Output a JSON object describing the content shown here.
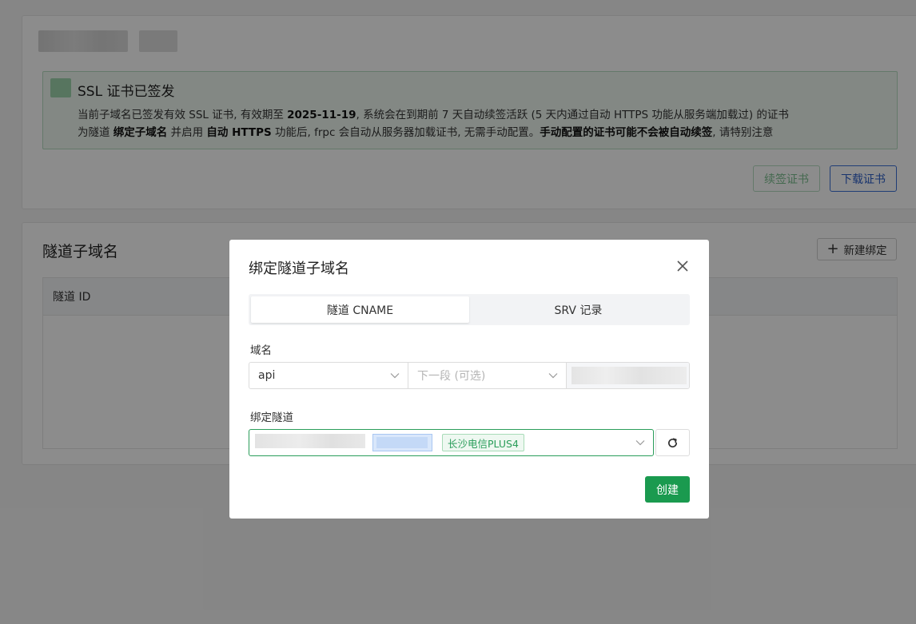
{
  "cert_card": {
    "alert": {
      "title": "SSL 证书已签发",
      "line1_prefix": "当前子域名已签发有效 SSL 证书, 有效期至 ",
      "expiry": "2025-11-19",
      "line1_suffix": ", 系统会在到期前 7 天自动续签活跃 (5 天内通过自动 HTTPS 功能从服务端加载过) 的证书",
      "line2_a": "为隧道 ",
      "line2_b": "绑定子域名",
      "line2_c": " 并启用 ",
      "line2_d": "自动 HTTPS",
      "line2_e": " 功能后, frpc 会自动从服务器加载证书, 无需手动配置。",
      "line2_f": "手动配置的证书可能不会被自动续签",
      "line2_g": ", 请特别注意"
    },
    "renew_label": "续签证书",
    "download_label": "下载证书"
  },
  "tunnel_card": {
    "title": "隧道子域名",
    "new_binding_label": "新建绑定",
    "table_columns": [
      "隧道 ID"
    ]
  },
  "modal": {
    "title": "绑定隧道子域名",
    "tabs": [
      {
        "label": "隧道 CNAME",
        "active": true
      },
      {
        "label": "SRV 记录",
        "active": false
      }
    ],
    "domain_label": "域名",
    "subdomain_value": "api",
    "next_segment_placeholder": "下一段 (可选)",
    "tunnel_label": "绑定隧道",
    "tunnel_node_tag": "长沙电信PLUS4",
    "create_label": "创建"
  },
  "colors": {
    "primary_green": "#1a9a4f",
    "accent_blue": "#2d5fc8",
    "overlay": "rgba(0,0,0,0.45)"
  }
}
